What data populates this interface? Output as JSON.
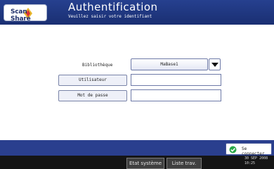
{
  "header": {
    "logo_text": "Scan Share",
    "title": "Authentification",
    "subtitle": "Veuillez saisir votre identifiant"
  },
  "form": {
    "library_label": "Bibliothèque",
    "library_value": "MaBase1",
    "user_button": "Utilisateur",
    "password_button": "Mot de passe",
    "user_value": "",
    "password_value": ""
  },
  "actions": {
    "connect_label": "Se connecter"
  },
  "footer": {
    "system_status": "Etat système",
    "job_list": "Liste trav.",
    "date": "30 SEP  2008",
    "time": "10:25"
  },
  "colors": {
    "header": "#1f3580",
    "band": "#2a3f8e",
    "connect_icon": "#2aa84a"
  }
}
